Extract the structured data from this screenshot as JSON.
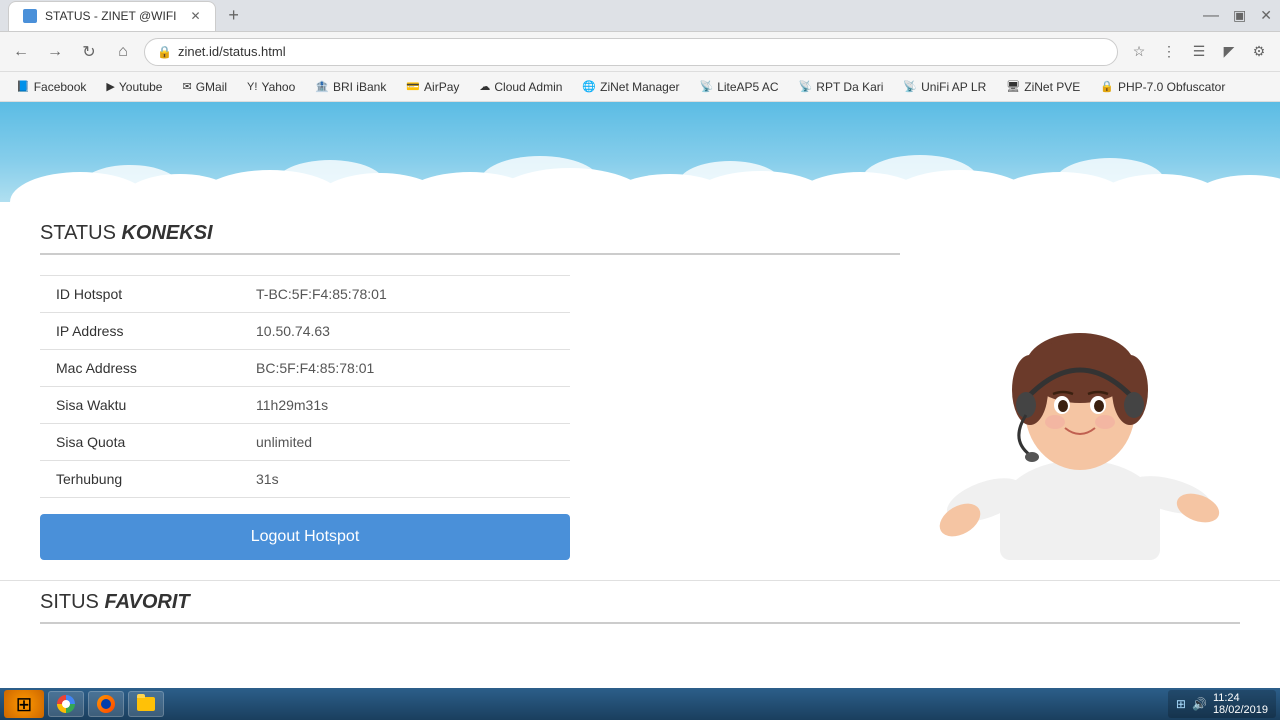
{
  "browser": {
    "tab_title": "STATUS - ZINET @WIFI",
    "url": "zinet.id/status.html",
    "new_tab_label": "+"
  },
  "bookmarks": [
    {
      "label": "Facebook",
      "color": "#3b5998"
    },
    {
      "label": "Youtube",
      "color": "#ff0000"
    },
    {
      "label": "GMail",
      "color": "#ea4335"
    },
    {
      "label": "Yahoo",
      "color": "#6001d2"
    },
    {
      "label": "BRI iBank",
      "color": "#003087"
    },
    {
      "label": "AirPay",
      "color": "#00aaff"
    },
    {
      "label": "Cloud Admin",
      "color": "#4a90d9"
    },
    {
      "label": "ZiNet Manager",
      "color": "#2ecc71"
    },
    {
      "label": "LiteAP5 AC",
      "color": "#888"
    },
    {
      "label": "RPT Da Kari",
      "color": "#888"
    },
    {
      "label": "UniFi AP LR",
      "color": "#888"
    },
    {
      "label": "ZiNet PVE",
      "color": "#e74c3c"
    },
    {
      "label": "PHP-7.0 Obfuscator",
      "color": "#8e44ad"
    }
  ],
  "page": {
    "status_title": "STATUS ",
    "status_title_em": "KONEKSI",
    "fields": [
      {
        "label": "ID Hotspot",
        "value": "T-BC:5F:F4:85:78:01"
      },
      {
        "label": "IP Address",
        "value": "10.50.74.63"
      },
      {
        "label": "Mac Address",
        "value": "BC:5F:F4:85:78:01"
      },
      {
        "label": "Sisa Waktu",
        "value": "11h29m31s"
      },
      {
        "label": "Sisa Quota",
        "value": "unlimited"
      },
      {
        "label": "Terhubung",
        "value": "31s"
      }
    ],
    "logout_btn": "Logout Hotspot",
    "situs_title": "SITUS ",
    "situs_title_em": "FAVORIT"
  },
  "taskbar": {
    "time": "11:24",
    "date": "18/02/2019"
  }
}
